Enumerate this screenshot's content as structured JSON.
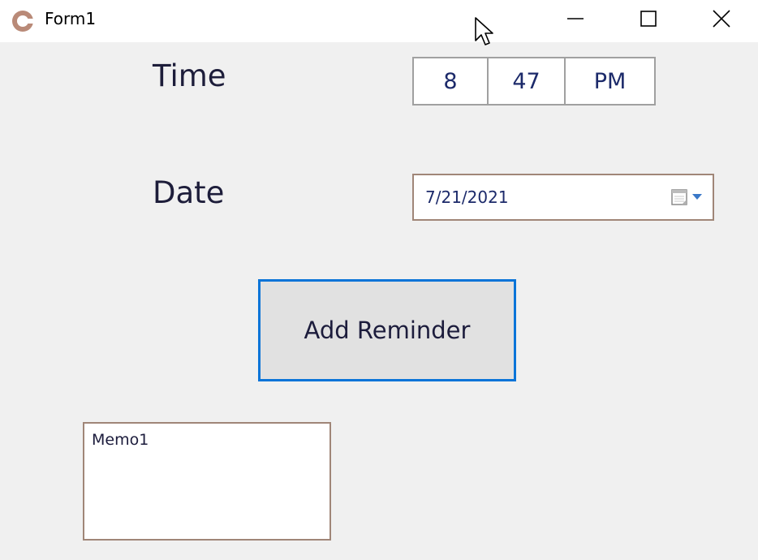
{
  "window": {
    "title": "Form1"
  },
  "form": {
    "time_label": "Time",
    "date_label": "Date",
    "time_hour": "8",
    "time_minute": "47",
    "time_ampm": "PM",
    "date_value": "7/21/2021",
    "add_button_label": "Add Reminder",
    "memo_text": "Memo1"
  },
  "colors": {
    "accent": "#0a74d8",
    "background": "#f0f0f0",
    "text_blue": "#1c2a6a",
    "border": "#a08678"
  },
  "icons": {
    "app": "app-icon",
    "minimize": "minimize-icon",
    "maximize": "maximize-icon",
    "close": "close-icon",
    "calendar": "calendar-icon",
    "dropdown": "chevron-down-icon",
    "cursor": "mouse-cursor-icon"
  }
}
